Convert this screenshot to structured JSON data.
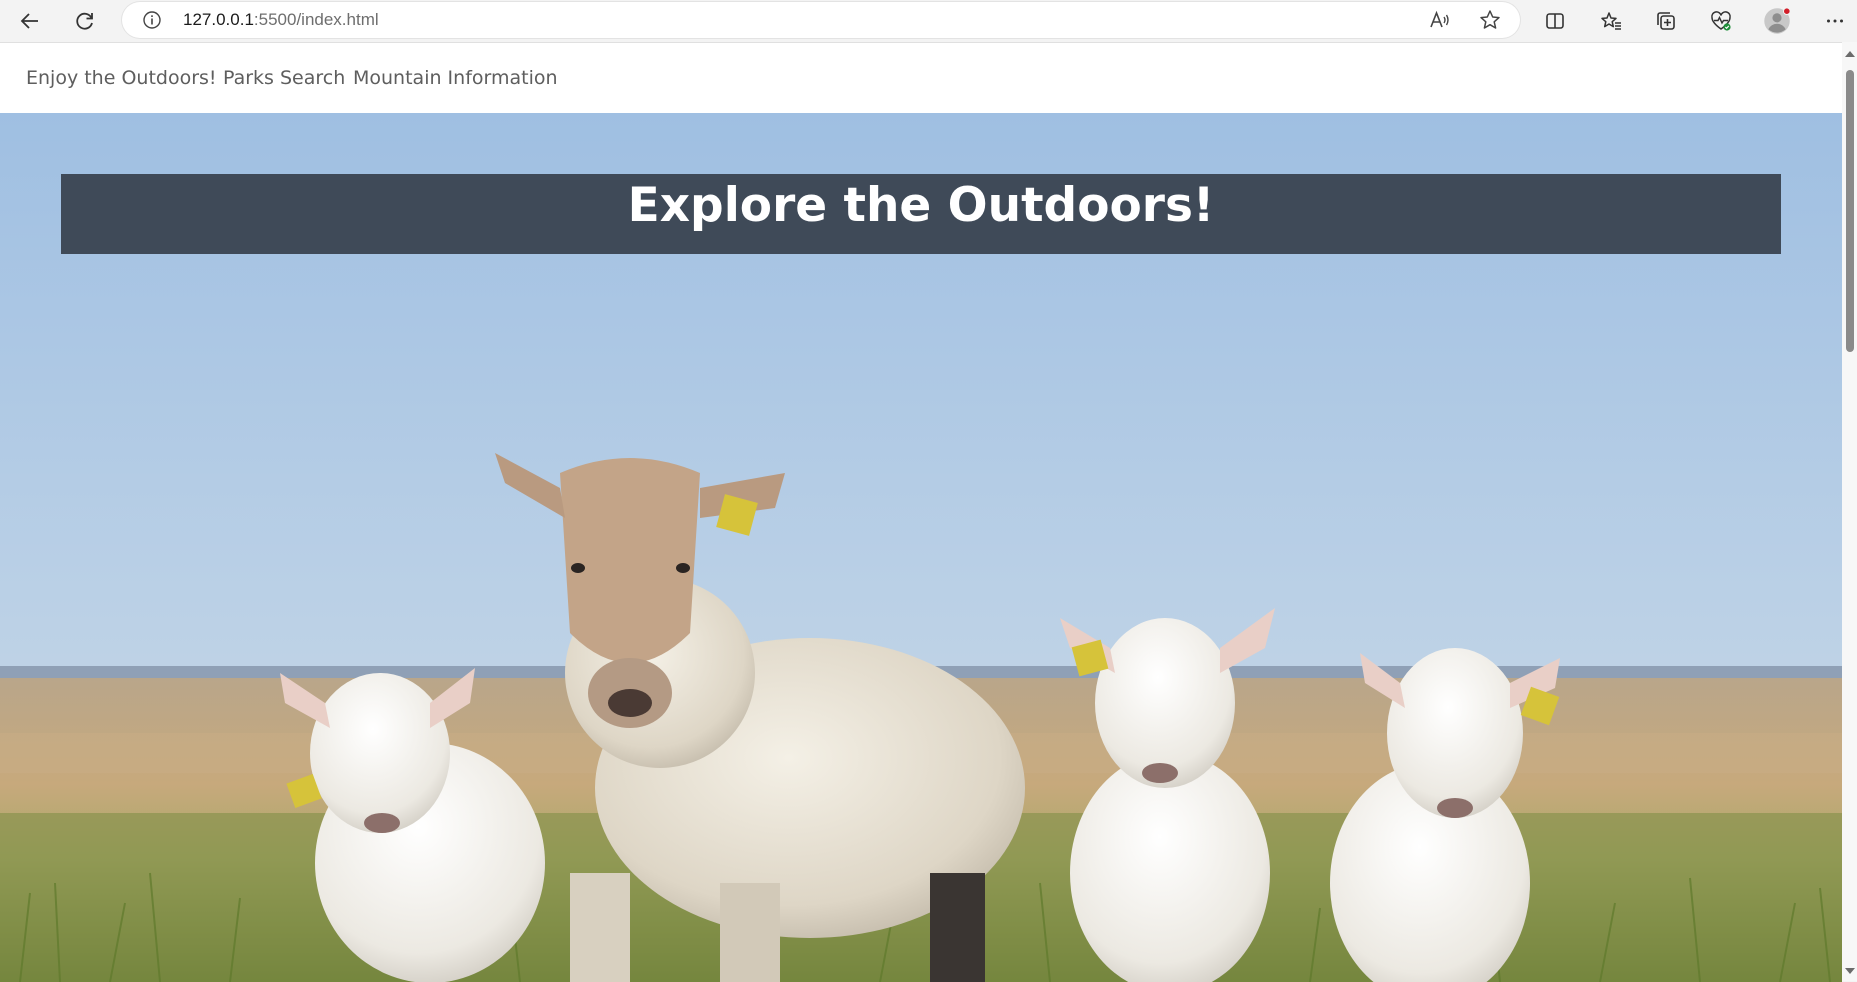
{
  "browser": {
    "url_host": "127.0.0.1",
    "url_path": ":5500/index.html",
    "icons": {
      "back": "back-arrow-icon",
      "refresh": "refresh-icon",
      "info": "info-icon",
      "read_aloud": "read-aloud-icon",
      "favorite": "star-icon",
      "split_screen": "split-screen-icon",
      "favorites": "favorites-icon",
      "collections": "collections-icon",
      "performance": "heartbeat-icon",
      "profile": "profile-avatar-icon",
      "more": "more-icon"
    }
  },
  "nav": {
    "brand": "Enjoy the Outdoors!",
    "links": [
      "Parks Search",
      "Mountain Information"
    ]
  },
  "hero": {
    "title": "Explore the Outdoors!",
    "image": "sheep-in-meadow-photo"
  },
  "colors": {
    "title_box": "#3f4a58",
    "sky_top": "#9fbfe2",
    "grass": "#8a9a4a"
  }
}
